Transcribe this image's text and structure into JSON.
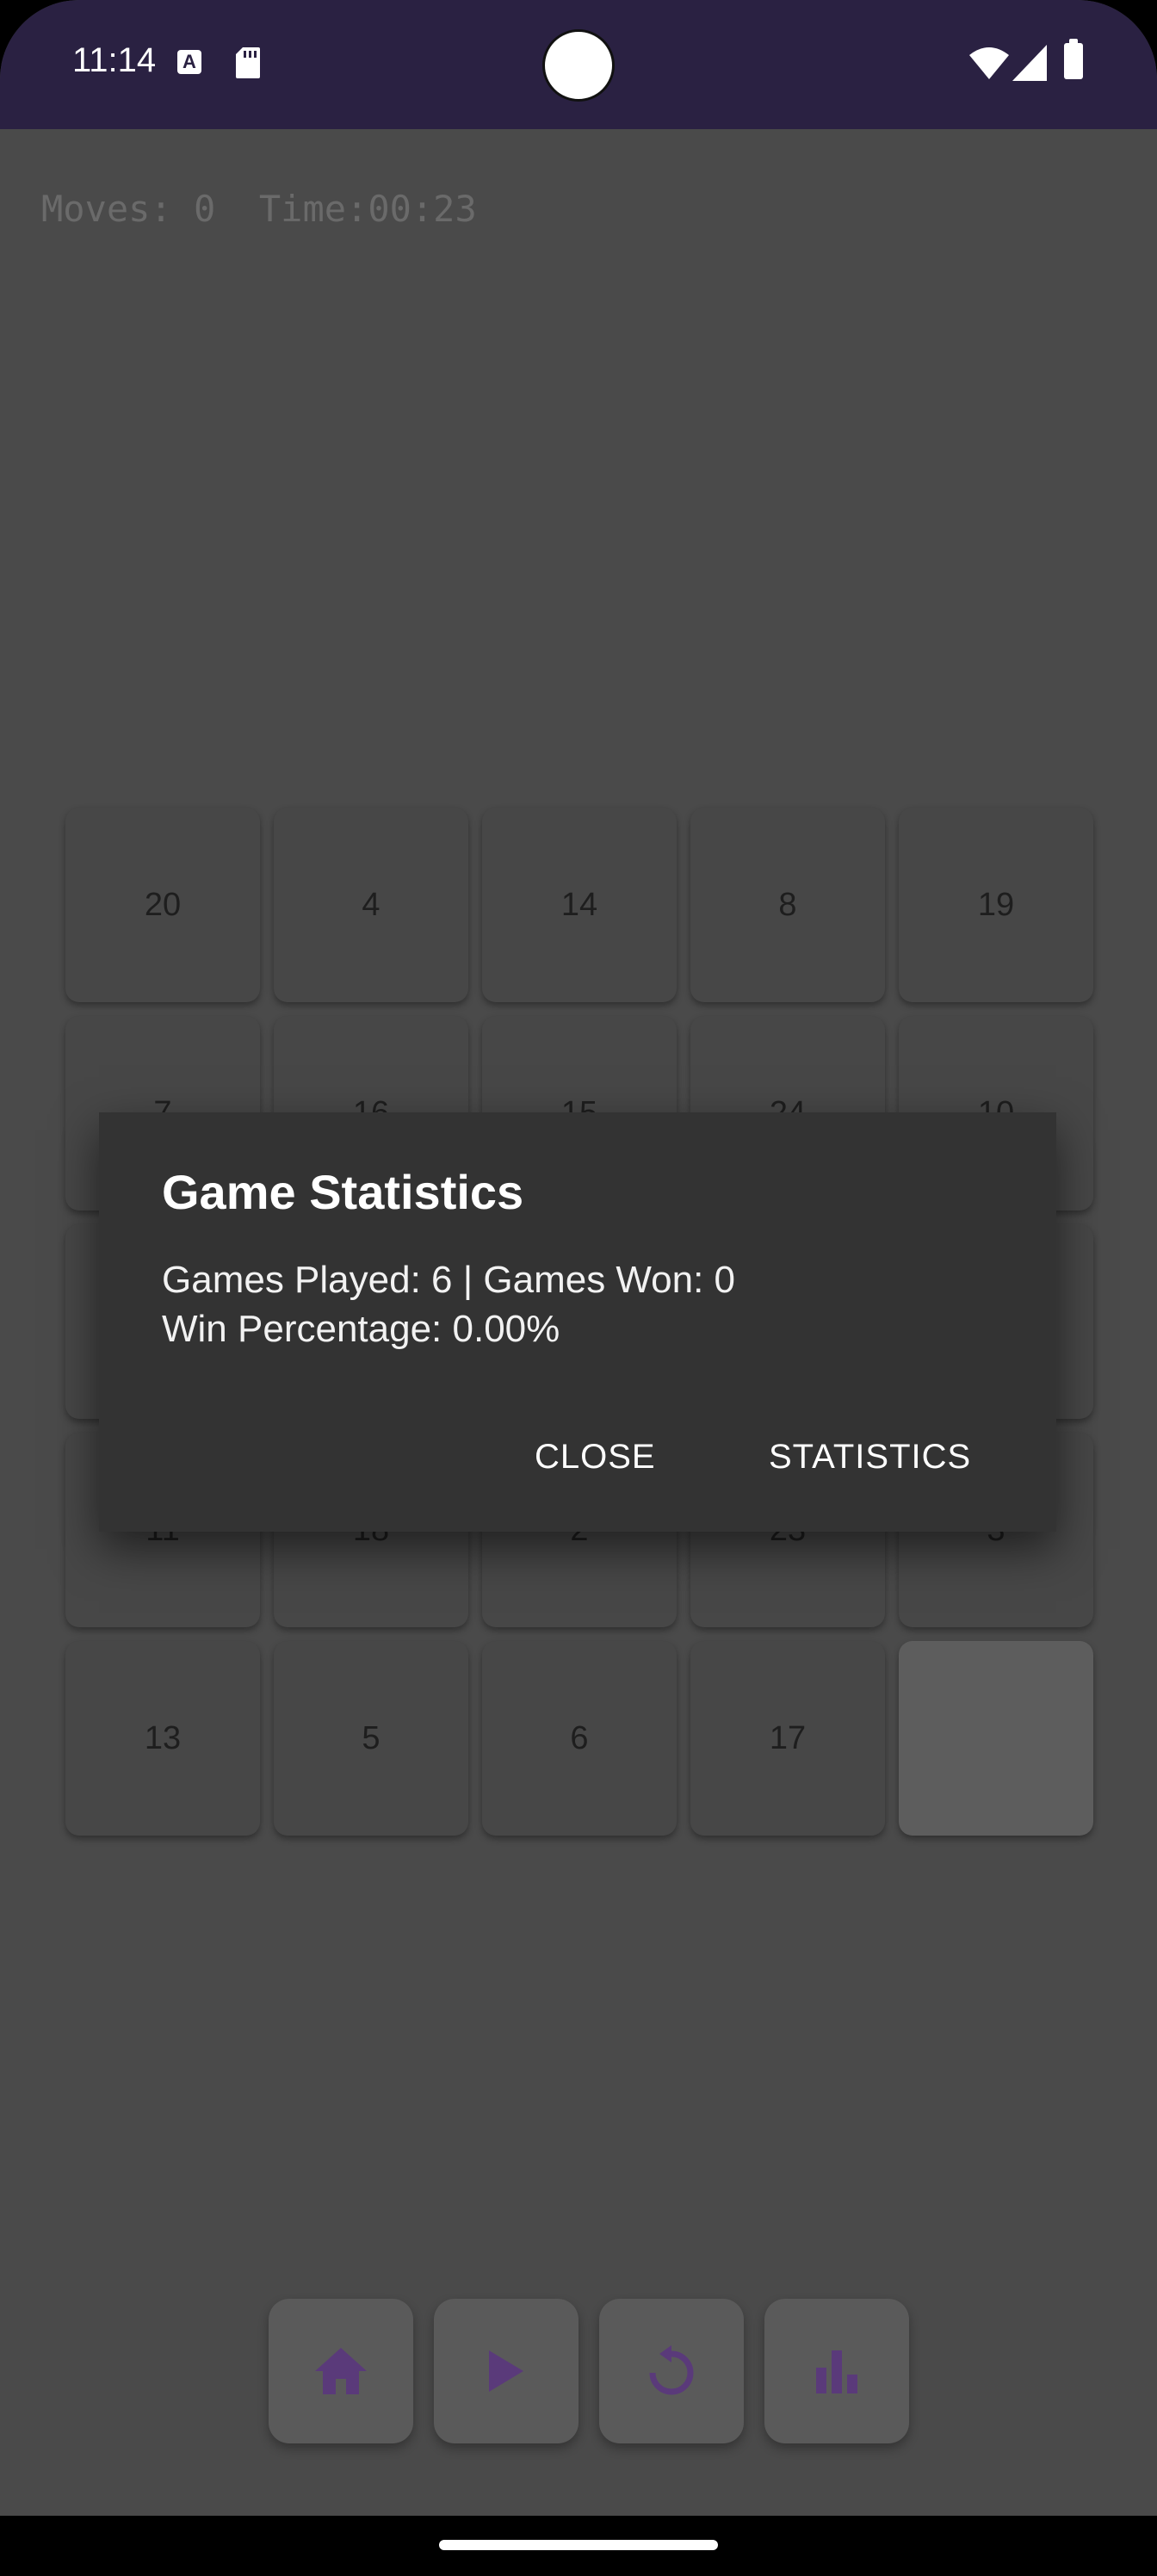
{
  "status_bar": {
    "time": "11:14",
    "a_icon_letter": "A",
    "icons": [
      "a-icon",
      "sd-card-icon",
      "wifi-icon",
      "signal-icon",
      "battery-icon"
    ]
  },
  "hud": {
    "moves_label": "Moves:",
    "moves_value": "0",
    "time_label": "Time:",
    "time_value": "00:23"
  },
  "grid": {
    "tiles": [
      "20",
      "4",
      "14",
      "8",
      "19",
      "7",
      "16",
      "15",
      "24",
      "10",
      "",
      "",
      "",
      "",
      "",
      "11",
      "18",
      "2",
      "23",
      "3",
      "13",
      "5",
      "6",
      "17",
      ""
    ]
  },
  "dialog": {
    "title": "Game Statistics",
    "line1": "Games Played: 6 | Games Won: 0",
    "line2": "Win Percentage: 0.00%",
    "close_label": "CLOSE",
    "statistics_label": "STATISTICS"
  },
  "controls": {
    "icons": [
      "home-icon",
      "play-icon",
      "restart-icon",
      "bar-chart-icon"
    ],
    "accent_color": "#5a3a7a"
  }
}
